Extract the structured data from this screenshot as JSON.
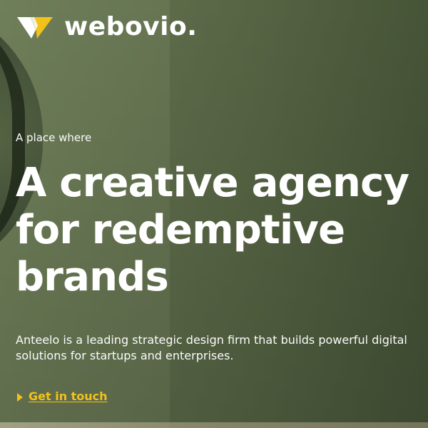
{
  "header": {
    "brand_name": "webovio."
  },
  "hero": {
    "eyebrow": "A place where",
    "headline": "A creative agency\nfor redemptive\nbrands",
    "description": "Anteelo is a leading strategic design firm that builds powerful digital\nsolutions for startups and enterprises.",
    "cta_label": "Get in touch"
  },
  "icons": {
    "logo": "logo-mark-icon",
    "cta": "play-triangle-icon"
  },
  "colors": {
    "primary_text": "#ffffff",
    "accent_yellow": "#f2c21b",
    "bg_green": "#657351"
  }
}
